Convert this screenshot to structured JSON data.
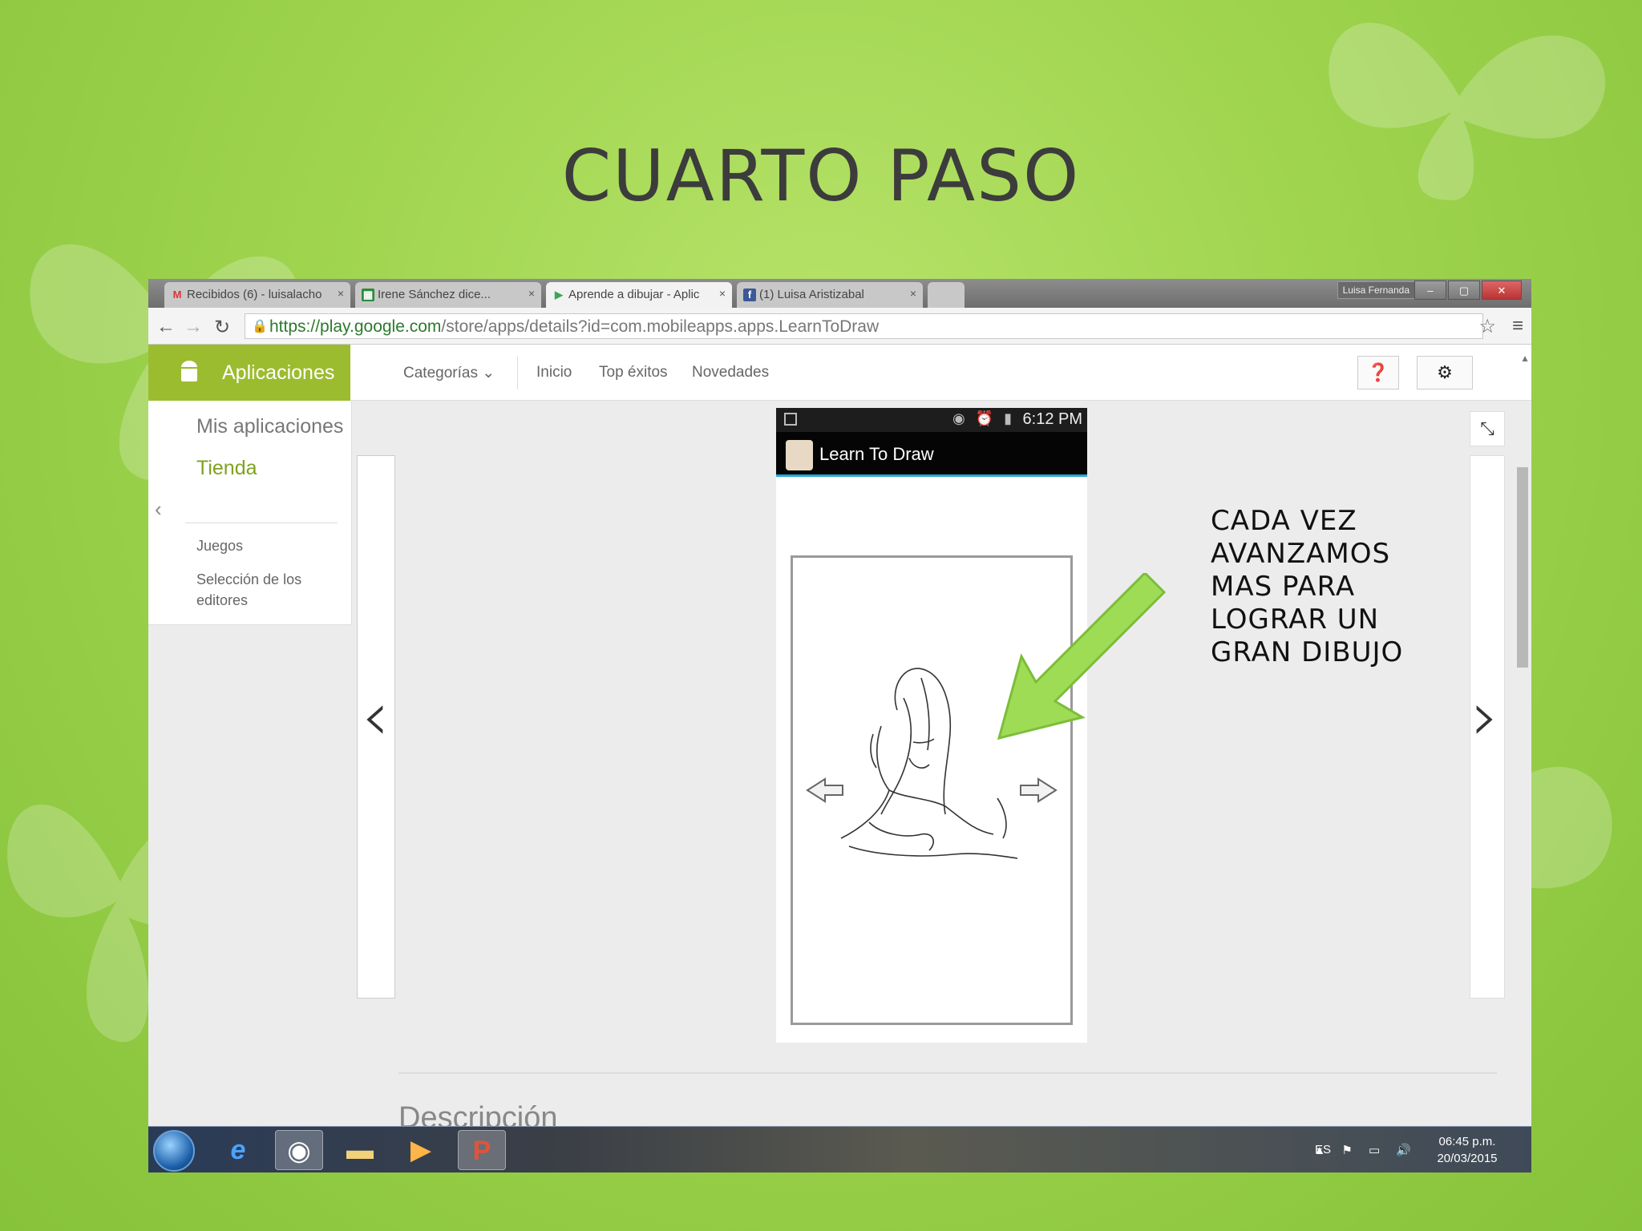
{
  "slide": {
    "title": "CUARTO PASO",
    "note_lines": [
      "CADA VEZ",
      "AVANZAMOS",
      "MAS PARA",
      "LOGRAR UN",
      "GRAN DIBUJO"
    ]
  },
  "browser": {
    "tabs": [
      {
        "icon": "gmail-icon",
        "label": "Recibidos (6) - luisalacho",
        "close": "×"
      },
      {
        "icon": "sheets-icon",
        "label": "Irene Sánchez dice...",
        "close": "×"
      },
      {
        "icon": "play-icon",
        "label": "Aprende a dibujar - Aplic",
        "close": "×"
      },
      {
        "icon": "facebook-icon",
        "label": "(1) Luisa Aristizabal",
        "close": "×"
      }
    ],
    "user": "Luisa Fernanda",
    "url_host": "https://play.google.com",
    "url_path": "/store/apps/details?id=com.mobileapps.apps.LearnToDraw"
  },
  "play": {
    "apps_label": "Aplicaciones",
    "nav": [
      "Categorías",
      "Inicio",
      "Top éxitos",
      "Novedades"
    ],
    "help_icon": "help-icon",
    "settings_icon": "gear-icon",
    "sidebar": {
      "my_apps": "Mis aplicaciones",
      "store": "Tienda",
      "games": "Juegos",
      "editors_1": "Selección de los",
      "editors_2": "editores"
    },
    "description_heading": "Descripción"
  },
  "phone": {
    "time": "6:12 PM",
    "app_title": "Learn To Draw"
  },
  "taskbar": {
    "lang": "ES",
    "time": "06:45 p.m.",
    "date": "20/03/2015"
  },
  "colors": {
    "background": "#9fd44e",
    "apps_accent": "#9cbc2f",
    "arrow": "#9fdc55"
  }
}
